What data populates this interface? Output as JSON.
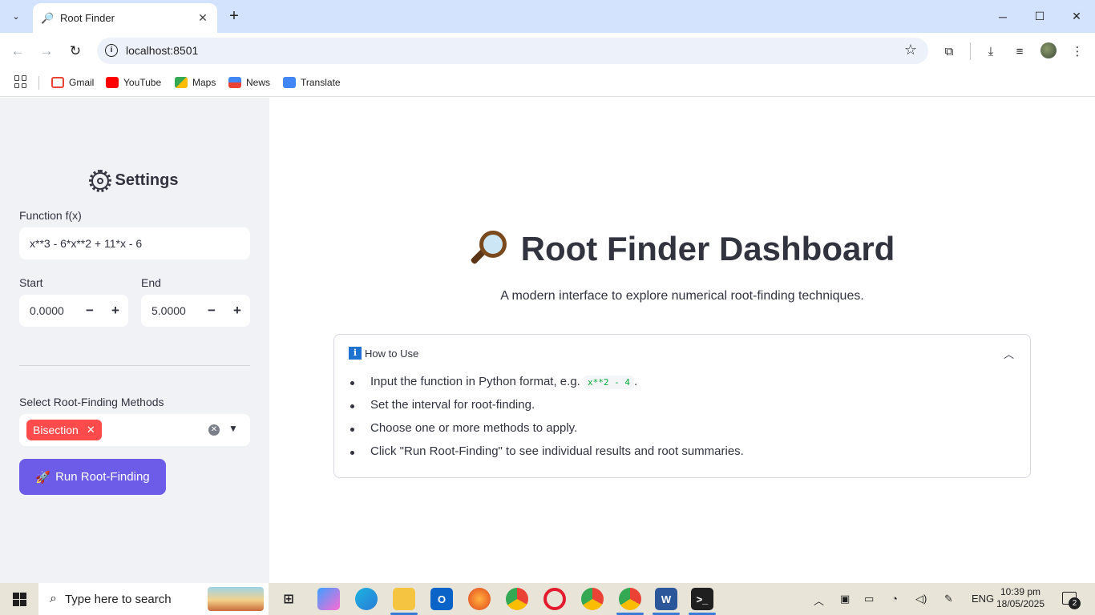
{
  "browser": {
    "tab_title": "Root Finder",
    "url": "localhost:8501",
    "bookmarks": [
      {
        "label": "Gmail",
        "icon": "gmail-icon",
        "color": "#ea4335"
      },
      {
        "label": "YouTube",
        "icon": "youtube-icon",
        "color": "#ff0000"
      },
      {
        "label": "Maps",
        "icon": "maps-icon",
        "color": "#34a853"
      },
      {
        "label": "News",
        "icon": "news-icon",
        "color": "#4285f4"
      },
      {
        "label": "Translate",
        "icon": "translate-icon",
        "color": "#4285f4"
      }
    ]
  },
  "sidebar": {
    "title": "Settings",
    "function_label": "Function f(x)",
    "function_value": "x**3 - 6*x**2 + 11*x - 6",
    "start_label": "Start",
    "start_value": "0.0000",
    "end_label": "End",
    "end_value": "5.0000",
    "methods_label": "Select Root-Finding Methods",
    "selected_methods": [
      "Bisection"
    ],
    "run_button": "Run Root-Finding",
    "accent_color": "#6c5ce7",
    "chip_color": "#ff4b4b"
  },
  "main": {
    "title": "Root Finder Dashboard",
    "subtitle": "A modern interface to explore numerical root-finding techniques.",
    "expander": {
      "title": "How to Use",
      "items": [
        {
          "before": "Input the function in Python format, e.g. ",
          "code": "x**2 - 4",
          "after": "."
        },
        {
          "text": "Set the interval for root-finding."
        },
        {
          "text": "Choose one or more methods to apply."
        },
        {
          "text": "Click \"Run Root-Finding\" to see individual results and root summaries."
        }
      ]
    }
  },
  "taskbar": {
    "search_placeholder": "Type here to search",
    "language": "ENG",
    "time": "10:39 pm",
    "date": "18/05/2025",
    "notification_count": "2"
  }
}
